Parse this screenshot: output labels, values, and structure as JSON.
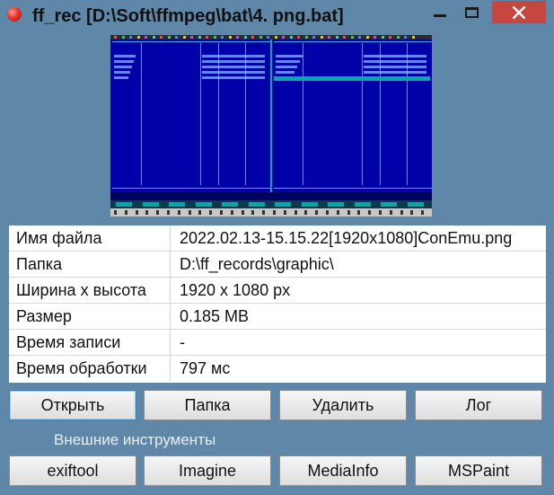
{
  "window": {
    "title": "ff_rec [D:\\Soft\\ffmpeg\\bat\\4. png.bat]"
  },
  "preview": {
    "icon": "conemu-far-manager-screenshot"
  },
  "info": {
    "rows": [
      {
        "label": "Имя файла",
        "value": "2022.02.13-15.15.22[1920x1080]ConEmu.png"
      },
      {
        "label": "Папка",
        "value": "D:\\ff_records\\graphic\\"
      },
      {
        "label": "Ширина x высота",
        "value": "1920 x 1080 px"
      },
      {
        "label": "Размер",
        "value": "0.185 MB"
      },
      {
        "label": "Время записи",
        "value": "-"
      },
      {
        "label": "Время обработки",
        "value": "797 мс"
      }
    ]
  },
  "actions": {
    "open": "Открыть",
    "folder": "Папка",
    "delete": "Удалить",
    "log": "Лог"
  },
  "external": {
    "label": "Внешние инструменты",
    "exiftool": "exiftool",
    "imagine": "Imagine",
    "mediainfo": "MediaInfo",
    "mspaint": "MSPaint"
  },
  "colors": {
    "window_bg": "#5f87a8",
    "close_button": "#c7463f",
    "preview_bg": "#0000a8"
  }
}
